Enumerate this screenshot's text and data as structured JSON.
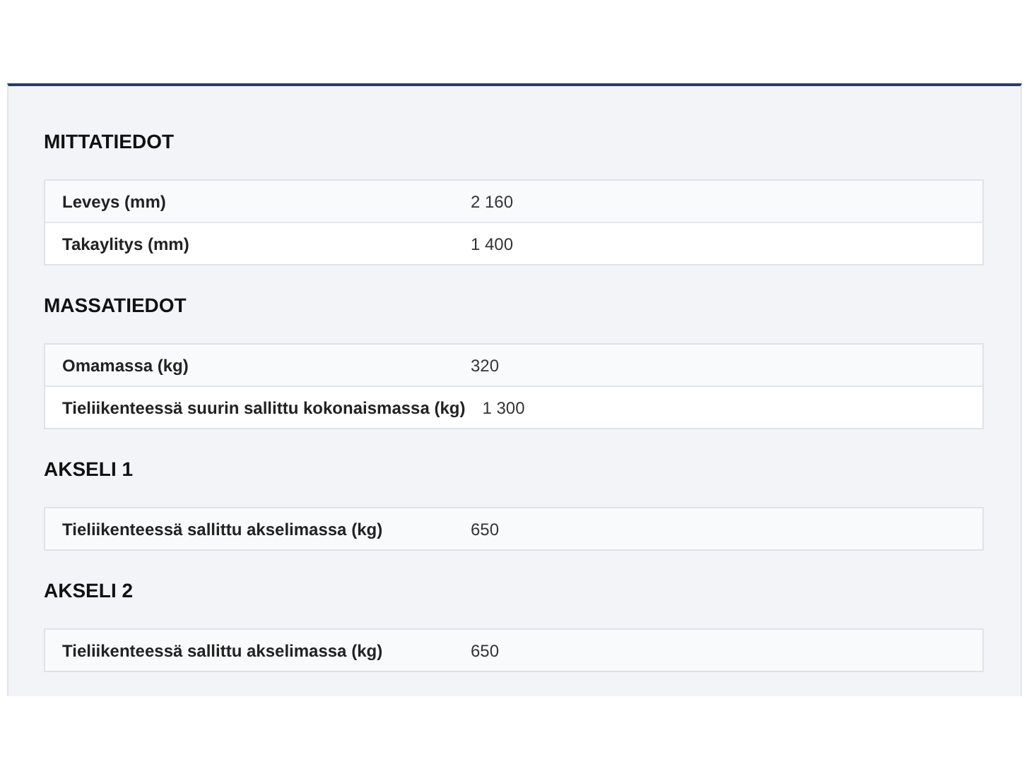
{
  "sections": [
    {
      "title": "MITTATIEDOT",
      "rows": [
        {
          "label": "Leveys (mm)",
          "value": "2 160"
        },
        {
          "label": "Takaylitys (mm)",
          "value": "1 400"
        }
      ]
    },
    {
      "title": "MASSATIEDOT",
      "rows": [
        {
          "label": "Omamassa (kg)",
          "value": "320"
        },
        {
          "label": "Tieliikenteessä suurin sallittu kokonaismassa (kg)",
          "value": "1 300"
        }
      ]
    },
    {
      "title": "AKSELI 1",
      "rows": [
        {
          "label": "Tieliikenteessä sallittu akselimassa (kg)",
          "value": "650"
        }
      ]
    },
    {
      "title": "AKSELI 2",
      "rows": [
        {
          "label": "Tieliikenteessä sallittu akselimassa (kg)",
          "value": "650"
        }
      ]
    }
  ]
}
